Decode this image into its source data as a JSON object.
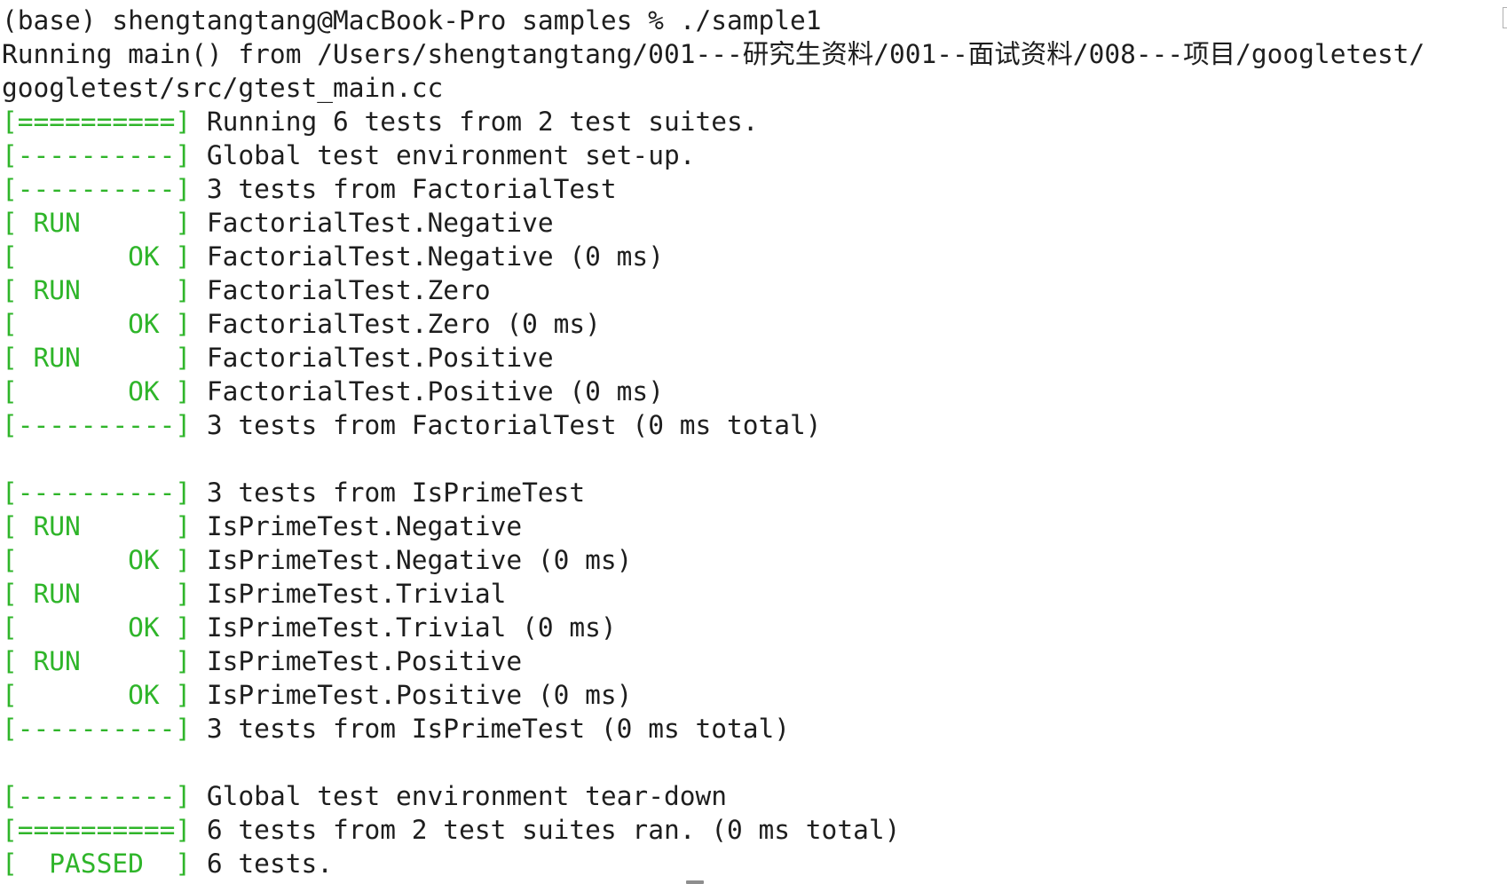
{
  "terminal": {
    "colors": {
      "text": "#1e1e1e",
      "tag": "#2fb52a",
      "background": "#ffffff"
    },
    "lines": [
      {
        "type": "plain",
        "text": "(base) shengtangtang@MacBook-Pro samples % ./sample1"
      },
      {
        "type": "plain",
        "text": "Running main() from /Users/shengtangtang/001---研究生资料/001--面试资料/008---项目/googletest/"
      },
      {
        "type": "plain",
        "text": "googletest/src/gtest_main.cc"
      },
      {
        "type": "tag",
        "tag": "[==========]",
        "text": " Running 6 tests from 2 test suites."
      },
      {
        "type": "tag",
        "tag": "[----------]",
        "text": " Global test environment set-up."
      },
      {
        "type": "tag",
        "tag": "[----------]",
        "text": " 3 tests from FactorialTest"
      },
      {
        "type": "tag",
        "tag": "[ RUN      ]",
        "text": " FactorialTest.Negative"
      },
      {
        "type": "tag",
        "tag": "[       OK ]",
        "text": " FactorialTest.Negative (0 ms)"
      },
      {
        "type": "tag",
        "tag": "[ RUN      ]",
        "text": " FactorialTest.Zero"
      },
      {
        "type": "tag",
        "tag": "[       OK ]",
        "text": " FactorialTest.Zero (0 ms)"
      },
      {
        "type": "tag",
        "tag": "[ RUN      ]",
        "text": " FactorialTest.Positive"
      },
      {
        "type": "tag",
        "tag": "[       OK ]",
        "text": " FactorialTest.Positive (0 ms)"
      },
      {
        "type": "tag",
        "tag": "[----------]",
        "text": " 3 tests from FactorialTest (0 ms total)"
      },
      {
        "type": "plain",
        "text": ""
      },
      {
        "type": "tag",
        "tag": "[----------]",
        "text": " 3 tests from IsPrimeTest"
      },
      {
        "type": "tag",
        "tag": "[ RUN      ]",
        "text": " IsPrimeTest.Negative"
      },
      {
        "type": "tag",
        "tag": "[       OK ]",
        "text": " IsPrimeTest.Negative (0 ms)"
      },
      {
        "type": "tag",
        "tag": "[ RUN      ]",
        "text": " IsPrimeTest.Trivial"
      },
      {
        "type": "tag",
        "tag": "[       OK ]",
        "text": " IsPrimeTest.Trivial (0 ms)"
      },
      {
        "type": "tag",
        "tag": "[ RUN      ]",
        "text": " IsPrimeTest.Positive"
      },
      {
        "type": "tag",
        "tag": "[       OK ]",
        "text": " IsPrimeTest.Positive (0 ms)"
      },
      {
        "type": "tag",
        "tag": "[----------]",
        "text": " 3 tests from IsPrimeTest (0 ms total)"
      },
      {
        "type": "plain",
        "text": ""
      },
      {
        "type": "tag",
        "tag": "[----------]",
        "text": " Global test environment tear-down"
      },
      {
        "type": "tag",
        "tag": "[==========]",
        "text": " 6 tests from 2 test suites ran. (0 ms total)"
      },
      {
        "type": "tag",
        "tag": "[  PASSED  ]",
        "text": " 6 tests."
      }
    ]
  }
}
